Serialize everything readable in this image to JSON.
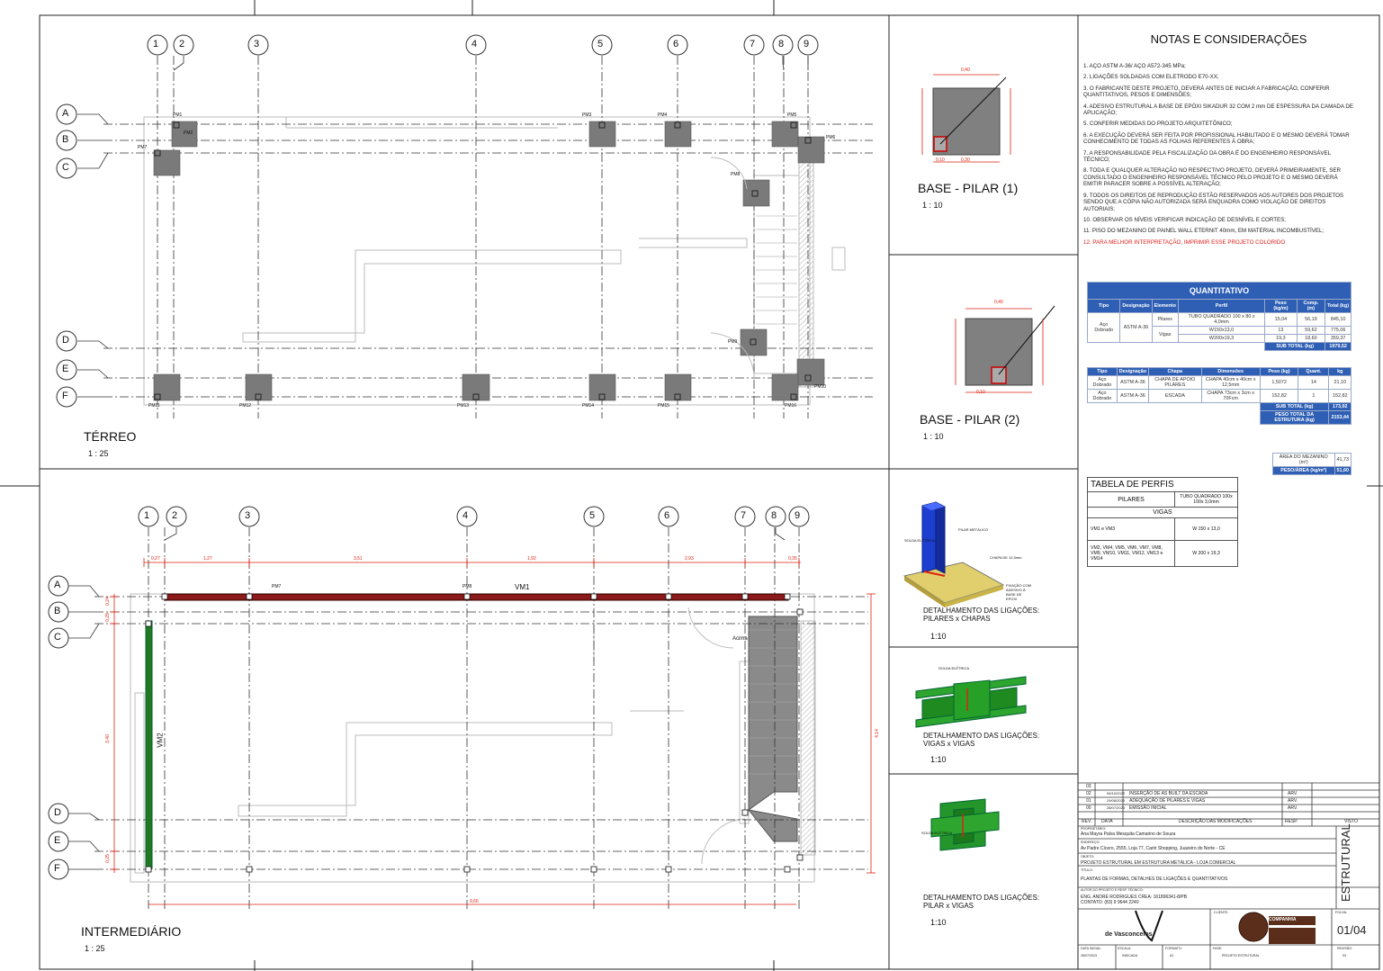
{
  "notes": {
    "title": "NOTAS E CONSIDERAÇÕES",
    "items": [
      "1. AÇO ASTM A-36/ AÇO A572-345 MPa;",
      "2. LIGAÇÕES SOLDADAS COM ELETRODO E70-XX;",
      "3. O FABRICANTE DESTE PROJETO, DEVERÁ ANTES DE INICIAR A FABRICAÇÃO, CONFERIR QUANTITATIVOS, PESOS E DIMENSÕES;",
      "4. ADESIVO ESTRUTURAL A BASE DE EPÓXI SIKADUR 32 COM 2 mm DE ESPESSURA DA CAMADA DE APLICAÇÃO;",
      "5. CONFERIR MEDIDAS DO PROJETO ARQUITETÔNICO;",
      "6. A EXECUÇÃO DEVERÁ SER FEITA POR PROFISSIONAL HABILITADO E O MESMO DEVERÁ TOMAR CONHECIMENTO DE TODAS AS FOLHAS REFERENTES À OBRA;",
      "7. A RESPONSABILIDADE PELA FISCALIZAÇÃO DA OBRA É DO ENGENHEIRO RESPONSÁVEL TÉCNICO;",
      "8. TODA E QUALQUER ALTERAÇÃO NO RESPECTIVO PROJETO, DEVERÁ PRIMEIRAMENTE, SER CONSULTADO O ENGENHEIRO RESPONSÁVEL TÉCNICO PELO PROJETO E O MESMO DEVERÁ EMITIR PARACER SOBRE A POSSÍVEL ALTERAÇÃO;",
      "9. TODOS OS DIREITOS DE REPRODUÇÃO ESTÃO RESERVADOS AOS AUTORES DOS PROJETOS SENDO QUE A CÓPIA NÃO AUTORIZADA SERÁ ENQUADRA COMO VIOLAÇÃO DE DIREITOS AUTORIAIS;",
      "10. OBSERVAR OS NÍVEIS VERIFICAR INDICAÇÃO DE DESNÍVEL E CORTES;",
      "11. PISO DO MEZANINO DE PAINEL WALL ETERNIT 40mm, EM MATERIAL INCOMBUSTÍVEL;"
    ],
    "red_item": "12. PARA MELHOR INTERPRETAÇÃO, IMPRIMIR ESSE PROJETO COLORIDO"
  },
  "quant": {
    "title": "QUANTITATIVO",
    "headers": [
      "Tipo",
      "Designação",
      "Elemento",
      "Perfil",
      "Peso (kg/m)",
      "Comp. (m)",
      "Total (kg)"
    ],
    "tipo": "Aço Dobrado",
    "designacao": "ASTM A-36",
    "pilares": "Pilares",
    "vigas": "Vigas",
    "perfil1": "TUBO QUADRADO 100 x 80 x 4,0mm",
    "perfil2": "W150x13,0",
    "perfil3": "W200x19,3",
    "peso1": "15,04",
    "comp1": "56,19",
    "tot1": "845,10",
    "peso2": "13",
    "comp2": "59,62",
    "tot2": "775,06",
    "peso3": "19,3",
    "comp3": "18,60",
    "tot3": "359,37",
    "subtotal_label": "SUB TOTAL (kg)",
    "subtotal": "1979,52",
    "h2": [
      "Tipo",
      "Designação",
      "Chapa",
      "Dimensões",
      "Peso (kg)",
      "Quant.",
      "kg"
    ],
    "chapa1": "CHAPA DE APOIO PILARES",
    "dim1": "CHAPA 40cm x 40cm x 12,5mm",
    "p1": "1,5072",
    "q1": "14",
    "k1": "21,10",
    "chapa2": "ESCADA",
    "dim2": "CHAPA 73cm x 3cm x 70Fcm",
    "p2": "152,82",
    "q2": "1",
    "k2": "152,82",
    "sub2_label": "SUB TOTAL (kg)",
    "sub2": "173,92",
    "peso_total_label": "PESO TOTAL DA ESTRUTURA (kg)",
    "peso_total": "2153,44",
    "area_label": "ÁREA DO MEZANINO (m²)",
    "area": "41,73",
    "peso_area_label": "PESO/ÁREA (kg/m²)",
    "peso_area": "51,60"
  },
  "perfis": {
    "title": "TABELA DE PERFIS",
    "pilares": "PILARES",
    "pilares_perfil": "TUBO QUADRADO 100x 100x 3,0mm",
    "vigas": "VIGAS",
    "v1": "VM1 e VM3",
    "v1p": "W 150 x 13,0",
    "v2": "VM2, VM4, VM5, VM6, VM7, VM8, VM9, VM10, VM11, VM12, VM13 e VM14",
    "v2p": "W 200 x 19,3"
  },
  "plans": {
    "terreo_title": "TÉRREO",
    "terreo_scale": "1 : 25",
    "inter_title": "INTERMEDIÁRIO",
    "inter_scale": "1 : 25",
    "cols": [
      "1",
      "2",
      "3",
      "4",
      "5",
      "6",
      "7",
      "8",
      "9"
    ],
    "rows": [
      "A",
      "B",
      "C",
      "D",
      "E",
      "F"
    ],
    "vm1": "VM1",
    "vm2": "VM2",
    "acima": "Acima",
    "dims_top": [
      "0,27",
      "1,27",
      "3,51",
      "1,92",
      "2,93",
      "0,35"
    ],
    "dim_bottom": "9,66",
    "dim_right": "4,14",
    "dims_left": [
      "0,24",
      "0,29",
      "3,40",
      "0,25"
    ],
    "pm": [
      "PM1",
      "PM2",
      "PM3",
      "PM4",
      "PM5",
      "PM6",
      "PM7",
      "PM8",
      "PM9",
      "PM10",
      "PM11",
      "PM12",
      "PM13",
      "PM14",
      "PM15",
      "PM16"
    ]
  },
  "details": {
    "base1": "BASE - PILAR (1)",
    "base1_scale": "1 : 10",
    "base2": "BASE - PILAR (2)",
    "base2_scale": "1 : 10",
    "d1a": "DETALHAMENTO DAS LIGAÇÕES:",
    "d1b": "PILARES x CHAPAS",
    "d1s": "1:10",
    "d2a": "DETALHAMENTO DAS LIGAÇÕES:",
    "d2b": "VIGAS x VIGAS",
    "d2s": "1:10",
    "d3a": "DETALHAMENTO DAS LIGAÇÕES:",
    "d3b": "PILAR x VIGAS",
    "d3s": "1:10",
    "dim40": "0,40",
    "dim30": "0,30",
    "dim10": "0,10",
    "pilar_label": "PILAR METÁLICO",
    "solda_label": "SOLDA ELÉTRICA",
    "chapa_label": "CHAPA DE 12,5mm",
    "fix_label": "FIXAÇÃO COM ADESIVO À BASE DE EPÓXI"
  },
  "titleblock": {
    "revs": [
      {
        "n": "03",
        "date": "",
        "desc": "",
        "resp": ""
      },
      {
        "n": "02",
        "date": "06/10/2023",
        "desc": "INSERÇÃO DE AS BUILT DA ESCADA",
        "resp": "ARV."
      },
      {
        "n": "01",
        "date": "29/08/2023",
        "desc": "ADEQUAÇÃO DE PILARES E VIGAS",
        "resp": "ARV."
      },
      {
        "n": "00",
        "date": "28/07/2023",
        "desc": "EMISSÃO INICIAL",
        "resp": "ARV."
      }
    ],
    "hdr_rev": "REV.",
    "hdr_data": "DATA",
    "hdr_desc": "DESCRIÇÃO DAS MODIFICAÇÕES",
    "hdr_resp": "RESP.",
    "hdr_visto": "VISTO",
    "prop_label": "PROPRIETÁRIO:",
    "prop": "Ana Mayra Palva Mesquita Camarino de Souza",
    "end_label": "ENDEREÇO:",
    "end": "Av Padre Cícero, 2555, Loja 77, Cariri Shopping, Juazeiro do Norte - CE",
    "obj_label": "OBJETO:",
    "obj": "PROJETO ESTRUTURAL EM ESTRUTURA METÁLICA - LOJA COMERCIAL",
    "tit_label": "TÍTULO:",
    "tit": "PLANTAS DE FORMAS, DETALHES DE LIGAÇÕES E QUANTITATIVOS",
    "autor_label": "AUTOR DO PROJETO E RESP. TÉCNICO:",
    "autor": "ENG. ANDRÉ RODRIGUES CREA: 161896341-8/PB",
    "contato": "CONTATO: (83) 9 9644 2240",
    "estrutural": "ESTRUTURAL",
    "folha_label": "FOLHA:",
    "folha": "01/04",
    "cliente_label": "CLIENTE:",
    "companhia": "COMPANHIA",
    "data_label": "DATA INICIAL:",
    "data": "28/07/2023",
    "escala_label": "ESCALA:",
    "escala": "INDICADA",
    "formato_label": "FORMATO:",
    "formato": "A1",
    "fase_label": "FASE:",
    "fase": "PROJETO ESTRUTURAL",
    "revisao_label": "REVISÃO:",
    "revisao": "03",
    "logo_text": "de Vasconcelos"
  }
}
